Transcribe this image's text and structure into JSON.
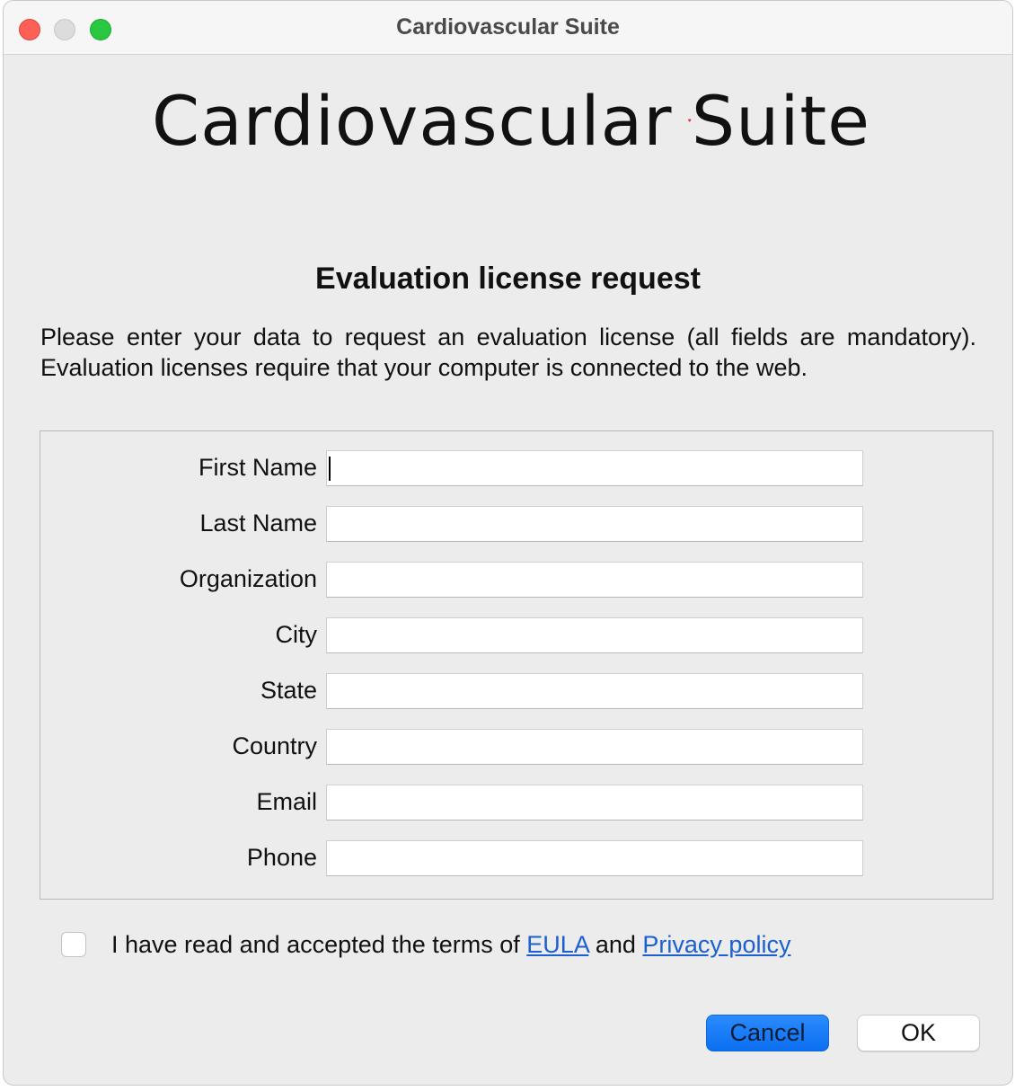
{
  "window": {
    "title": "Cardiovascular Suite"
  },
  "logo": {
    "word1": "Cardiovascular",
    "word2": "Suite",
    "heart_color": "#e5322d"
  },
  "heading": "Evaluation license request",
  "intro": {
    "line1": "Please enter your data to request an evaluation license (all fields are mandatory).",
    "line2": "Evaluation licenses require that your computer is connected to the web."
  },
  "form": {
    "fields": [
      {
        "label": "First Name",
        "value": ""
      },
      {
        "label": "Last Name",
        "value": ""
      },
      {
        "label": "Organization",
        "value": ""
      },
      {
        "label": "City",
        "value": ""
      },
      {
        "label": "State",
        "value": ""
      },
      {
        "label": "Country",
        "value": ""
      },
      {
        "label": "Email",
        "value": ""
      },
      {
        "label": "Phone",
        "value": ""
      }
    ]
  },
  "eula": {
    "checked": false,
    "text_before": "I have read and accepted the terms of ",
    "eula_link": "EULA",
    "text_middle": " and ",
    "privacy_link": "Privacy policy"
  },
  "buttons": {
    "cancel": "Cancel",
    "ok": "OK"
  },
  "colors": {
    "accent": "#0a6ef0",
    "link": "#1b5fd0"
  }
}
